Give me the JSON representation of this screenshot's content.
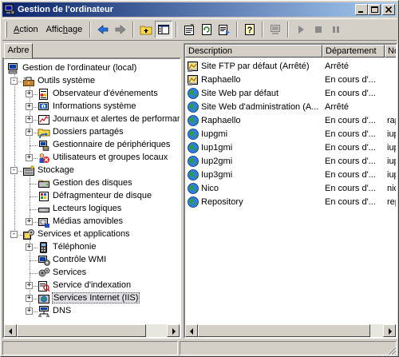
{
  "window": {
    "title": "Gestion de l'ordinateur"
  },
  "menu": {
    "action": {
      "accel": "A",
      "rest": "ction"
    },
    "view": {
      "pre": "Affic",
      "accel": "h",
      "rest": "age"
    }
  },
  "tab": {
    "label": "Arbre"
  },
  "tree": {
    "root": "Gestion de l'ordinateur (local)",
    "system_tools": "Outils système",
    "event_viewer": "Observateur d'événements",
    "system_info": "Informations système",
    "perf_logs": "Journaux et alertes de performance",
    "shared_folders": "Dossiers partagés",
    "device_manager": "Gestionnaire de périphériques",
    "local_users": "Utilisateurs et groupes locaux",
    "storage": "Stockage",
    "disk_mgmt": "Gestion des disques",
    "defrag": "Défragmenteur de disque",
    "logical_drives": "Lecteurs logiques",
    "removable": "Médias amovibles",
    "services_apps": "Services et applications",
    "telephony": "Téléphonie",
    "wmi": "Contrôle WMI",
    "services": "Services",
    "indexing": "Service d'indexation",
    "iis": "Services Internet (IIS)",
    "dns": "DNS"
  },
  "list": {
    "columns": {
      "description": "Description",
      "department": "Département",
      "third": "No"
    },
    "rows": [
      {
        "description": "Site FTP par défaut (Arrêté)",
        "department": "Arrêté",
        "third": "",
        "icon": "ftp-site-icon"
      },
      {
        "description": "Raphaello",
        "department": "En cours d'...",
        "third": "",
        "icon": "ftp-site-icon"
      },
      {
        "description": "Site Web par défaut",
        "department": "En cours d'...",
        "third": "",
        "icon": "web-site-icon"
      },
      {
        "description": "Site Web d'administration (A...",
        "department": "Arrêté",
        "third": "",
        "icon": "web-site-icon"
      },
      {
        "description": "Raphaello",
        "department": "En cours d'...",
        "third": "rap",
        "icon": "web-site-icon"
      },
      {
        "description": "Iupgmi",
        "department": "En cours d'...",
        "third": "iup",
        "icon": "web-site-icon"
      },
      {
        "description": "Iup1gmi",
        "department": "En cours d'...",
        "third": "iup",
        "icon": "web-site-icon"
      },
      {
        "description": "Iup2gmi",
        "department": "En cours d'...",
        "third": "iup",
        "icon": "web-site-icon"
      },
      {
        "description": "Iup3gmi",
        "department": "En cours d'...",
        "third": "iup",
        "icon": "web-site-icon"
      },
      {
        "description": "Nico",
        "department": "En cours d'...",
        "third": "nic",
        "icon": "web-site-icon"
      },
      {
        "description": "Repository",
        "department": "En cours d'...",
        "third": "rep",
        "icon": "web-site-icon"
      }
    ]
  }
}
